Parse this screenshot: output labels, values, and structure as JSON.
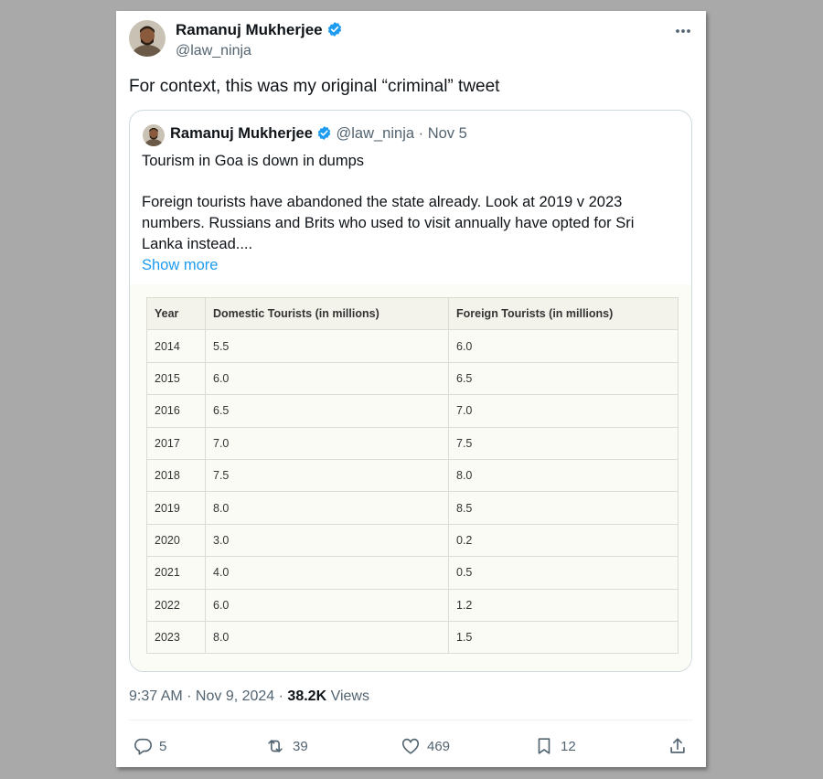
{
  "tweet": {
    "author_name": "Ramanuj Mukherjee",
    "author_handle": "@law_ninja",
    "text": "For context,  this was my original “criminal” tweet",
    "timestamp": "9:37 AM · Nov 9, 2024 · ",
    "views_count": "38.2K",
    "views_label": " Views"
  },
  "quoted": {
    "author_name": "Ramanuj Mukherjee",
    "meta": "@law_ninja · Nov 5",
    "line1": "Tourism in Goa is down in dumps",
    "line2": "Foreign tourists have abandoned the state already. Look at 2019 v 2023 numbers. Russians and Brits who used to visit annually have opted for Sri Lanka instead....",
    "show_more": "Show more"
  },
  "table": {
    "headers": [
      "Year",
      "Domestic Tourists (in millions)",
      "Foreign Tourists (in millions)"
    ],
    "rows": [
      [
        "2014",
        "5.5",
        "6.0"
      ],
      [
        "2015",
        "6.0",
        "6.5"
      ],
      [
        "2016",
        "6.5",
        "7.0"
      ],
      [
        "2017",
        "7.0",
        "7.5"
      ],
      [
        "2018",
        "7.5",
        "8.0"
      ],
      [
        "2019",
        "8.0",
        "8.5"
      ],
      [
        "2020",
        "3.0",
        "0.2"
      ],
      [
        "2021",
        "4.0",
        "0.5"
      ],
      [
        "2022",
        "6.0",
        "1.2"
      ],
      [
        "2023",
        "8.0",
        "1.5"
      ]
    ]
  },
  "actions": {
    "replies": "5",
    "reposts": "39",
    "likes": "469",
    "bookmarks": "12"
  },
  "icons": {
    "verified": "verified-badge-icon",
    "more": "more-options-icon",
    "reply": "reply-icon",
    "repost": "repost-icon",
    "like": "heart-icon",
    "bookmark": "bookmark-icon",
    "share": "share-icon"
  },
  "colors": {
    "accent": "#1d9bf0",
    "secondary_text": "#536471"
  }
}
